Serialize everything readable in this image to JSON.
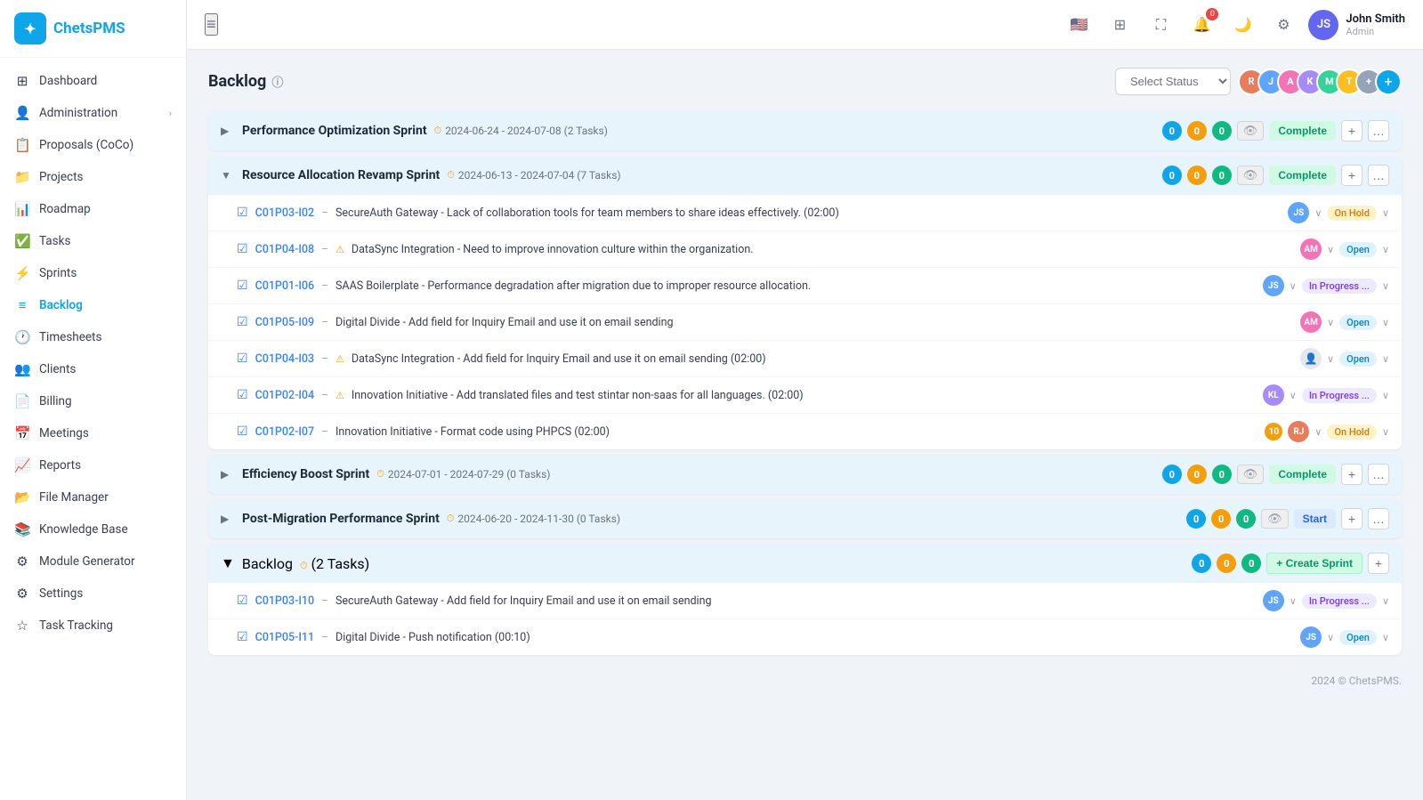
{
  "app": {
    "logo_text": "ChetsPMS",
    "logo_icon": "✦"
  },
  "sidebar": {
    "items": [
      {
        "id": "dashboard",
        "label": "Dashboard",
        "icon": "⊞"
      },
      {
        "id": "administration",
        "label": "Administration",
        "icon": "👤",
        "arrow": "›"
      },
      {
        "id": "proposals",
        "label": "Proposals (CoCo)",
        "icon": "📋"
      },
      {
        "id": "projects",
        "label": "Projects",
        "icon": "📁"
      },
      {
        "id": "roadmap",
        "label": "Roadmap",
        "icon": "📊"
      },
      {
        "id": "tasks",
        "label": "Tasks",
        "icon": "✅"
      },
      {
        "id": "sprints",
        "label": "Sprints",
        "icon": "⚡"
      },
      {
        "id": "backlog",
        "label": "Backlog",
        "icon": "≡",
        "active": true
      },
      {
        "id": "timesheets",
        "label": "Timesheets",
        "icon": "🕐"
      },
      {
        "id": "clients",
        "label": "Clients",
        "icon": "👥"
      },
      {
        "id": "billing",
        "label": "Billing",
        "icon": "📄"
      },
      {
        "id": "meetings",
        "label": "Meetings",
        "icon": "📅"
      },
      {
        "id": "reports",
        "label": "Reports",
        "icon": "📈"
      },
      {
        "id": "file-manager",
        "label": "File Manager",
        "icon": "📂"
      },
      {
        "id": "knowledge-base",
        "label": "Knowledge Base",
        "icon": "📚"
      },
      {
        "id": "module-generator",
        "label": "Module Generator",
        "icon": "⚙"
      },
      {
        "id": "settings",
        "label": "Settings",
        "icon": "⚙"
      },
      {
        "id": "task-tracking",
        "label": "Task Tracking",
        "icon": "☆"
      }
    ]
  },
  "topbar": {
    "hamburger_icon": "≡",
    "notification_count": "0",
    "user": {
      "name": "John Smith",
      "role": "Admin",
      "avatar_initials": "JS"
    }
  },
  "page": {
    "title": "Backlog",
    "info_icon": "ⓘ",
    "status_placeholder": "Select Status",
    "add_member_icon": "+",
    "footer": "2024 © ChetsPMS.",
    "avatar_colors": [
      "#e87c5b",
      "#a78bfa",
      "#34d399",
      "#60a5fa",
      "#f472b6",
      "#fbbf24",
      "#94a3b8"
    ]
  },
  "sprints": [
    {
      "id": "sprint1",
      "name": "Performance Optimization Sprint",
      "date_range": "2024-06-24 - 2024-07-08",
      "task_count": "2 Tasks",
      "collapsed": true,
      "counts": [
        0,
        0,
        0
      ],
      "status_label": "Complete",
      "status_type": "complete"
    },
    {
      "id": "sprint2",
      "name": "Resource Allocation Revamp Sprint",
      "date_range": "2024-06-13 - 2024-07-04",
      "task_count": "7 Tasks",
      "collapsed": false,
      "counts": [
        0,
        0,
        0
      ],
      "status_label": "Complete",
      "status_type": "complete",
      "tasks": [
        {
          "id": "C01P03-I02",
          "warn": false,
          "title": "SecureAuth Gateway - Lack of collaboration tools for team members to share ideas effectively. (02:00)",
          "avatar_color": "#60a5fa",
          "avatar_initials": "JS",
          "status": "On Hold",
          "status_type": "on-hold"
        },
        {
          "id": "C01P04-I08",
          "warn": true,
          "title": "DataSync Integration - Need to improve innovation culture within the organization.",
          "avatar_color": "#f472b6",
          "avatar_initials": "AM",
          "status": "Open",
          "status_type": "open"
        },
        {
          "id": "C01P01-I06",
          "warn": false,
          "title": "SAAS Boilerplate - Performance degradation after migration due to improper resource allocation.",
          "avatar_color": "#60a5fa",
          "avatar_initials": "JS",
          "status": "In Progress ...",
          "status_type": "in-progress"
        },
        {
          "id": "C01P05-I09",
          "warn": false,
          "title": "Digital Divide - Add field for Inquiry Email and use it on email sending",
          "avatar_color": "#f472b6",
          "avatar_initials": "AM",
          "status": "Open",
          "status_type": "open"
        },
        {
          "id": "C01P04-I03",
          "warn": true,
          "title": "DataSync Integration - Add field for Inquiry Email and use it on email sending (02:00)",
          "avatar_color": null,
          "avatar_initials": "",
          "status": "Open",
          "status_type": "open"
        },
        {
          "id": "C01P02-I04",
          "warn": true,
          "title": "Innovation Initiative - Add translated files and test stintar non-saas for all languages. (02:00)",
          "avatar_color": "#a78bfa",
          "avatar_initials": "KL",
          "status": "In Progress ...",
          "status_type": "in-progress"
        },
        {
          "id": "C01P02-I07",
          "warn": false,
          "title": "Innovation Initiative - Format code using PHPCS (02:00)",
          "number_badge": "10",
          "avatar_color": "#e87c5b",
          "avatar_initials": "RJ",
          "status": "On Hold",
          "status_type": "on-hold"
        }
      ]
    },
    {
      "id": "sprint3",
      "name": "Efficiency Boost Sprint",
      "date_range": "2024-07-01 - 2024-07-29",
      "task_count": "0 Tasks",
      "collapsed": true,
      "counts": [
        0,
        0,
        0
      ],
      "status_label": "Complete",
      "status_type": "complete"
    },
    {
      "id": "sprint4",
      "name": "Post-Migration Performance Sprint",
      "date_range": "2024-06-20 - 2024-11-30",
      "task_count": "0 Tasks",
      "collapsed": true,
      "counts": [
        0,
        0,
        0
      ],
      "status_label": "Start",
      "status_type": "start"
    },
    {
      "id": "backlog-section",
      "name": "Backlog",
      "task_count": "2 Tasks",
      "collapsed": false,
      "counts": [
        0,
        0,
        0
      ],
      "is_backlog": true,
      "tasks": [
        {
          "id": "C01P03-I10",
          "warn": false,
          "title": "SecureAuth Gateway - Add field for Inquiry Email and use it on email sending",
          "avatar_color": "#60a5fa",
          "avatar_initials": "JS",
          "status": "In Progress ...",
          "status_type": "in-progress"
        },
        {
          "id": "C01P05-I11",
          "warn": false,
          "title": "Digital Divide - Push notification (00:10)",
          "avatar_color": "#60a5fa",
          "avatar_initials": "JS",
          "status": "Open",
          "status_type": "open"
        }
      ]
    }
  ]
}
